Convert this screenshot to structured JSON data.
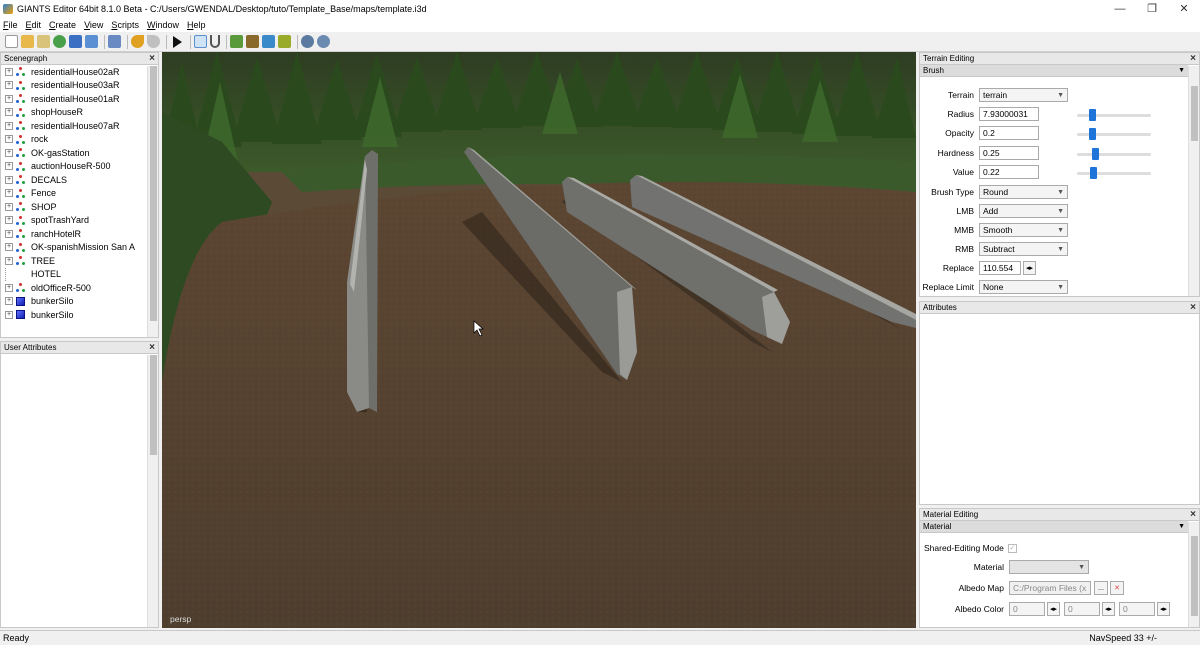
{
  "window": {
    "title": "GIANTS Editor 64bit 8.1.0 Beta - C:/Users/GWENDAL/Desktop/tuto/Template_Base/maps/template.i3d",
    "minimize": "—",
    "restore": "❐",
    "close": "✕"
  },
  "menu": [
    "File",
    "Edit",
    "Create",
    "View",
    "Scripts",
    "Window",
    "Help"
  ],
  "scenegraph": {
    "title": "Scenegraph",
    "items": [
      {
        "label": "residentialHouse02aR",
        "kind": "node"
      },
      {
        "label": "residentialHouse03aR",
        "kind": "node"
      },
      {
        "label": "residentialHouse01aR",
        "kind": "node"
      },
      {
        "label": "shopHouseR",
        "kind": "node"
      },
      {
        "label": "residentialHouse07aR",
        "kind": "node"
      },
      {
        "label": "rock",
        "kind": "node"
      },
      {
        "label": "OK-gasStation",
        "kind": "node"
      },
      {
        "label": "auctionHouseR-500",
        "kind": "node"
      },
      {
        "label": "DECALS",
        "kind": "node"
      },
      {
        "label": "Fence",
        "kind": "node"
      },
      {
        "label": "SHOP",
        "kind": "node"
      },
      {
        "label": "spotTrashYard",
        "kind": "node"
      },
      {
        "label": "ranchHotelR",
        "kind": "node"
      },
      {
        "label": "OK-spanishMission San A",
        "kind": "node"
      },
      {
        "label": "TREE",
        "kind": "node"
      },
      {
        "label": "HOTEL",
        "kind": "leaf"
      },
      {
        "label": "oldOfficeR-500",
        "kind": "node"
      },
      {
        "label": "bunkerSilo",
        "kind": "shape"
      },
      {
        "label": "bunkerSilo",
        "kind": "shape"
      }
    ]
  },
  "user_attributes": {
    "title": "User Attributes"
  },
  "viewport": {
    "camera_label": "persp"
  },
  "terrain_editing": {
    "title": "Terrain Editing",
    "section": "Brush",
    "terrain_label": "Terrain",
    "terrain_value": "terrain",
    "radius_label": "Radius",
    "radius_value": "7.93000031",
    "radius_level": 0.2,
    "opacity_label": "Opacity",
    "opacity_value": "0.2",
    "opacity_level": 0.2,
    "hardness_label": "Hardness",
    "hardness_value": "0.25",
    "hardness_level": 0.25,
    "value_label": "Value",
    "value_value": "0.22",
    "value_level": 0.22,
    "brush_type_label": "Brush Type",
    "brush_type_value": "Round",
    "lmb_label": "LMB",
    "lmb_value": "Add",
    "mmb_label": "MMB",
    "mmb_value": "Smooth",
    "rmb_label": "RMB",
    "rmb_value": "Subtract",
    "replace_label": "Replace",
    "replace_value": "110.554",
    "replace_limit_label": "Replace Limit",
    "replace_limit_value": "None"
  },
  "attributes": {
    "title": "Attributes"
  },
  "material_editing": {
    "title": "Material Editing",
    "section": "Material",
    "shared_mode_label": "Shared-Editing Mode",
    "material_label": "Material",
    "albedo_map_label": "Albedo Map",
    "albedo_map_value": "C:/Program Files (x",
    "albedo_map_browse": "...",
    "albedo_color_label": "Albedo Color",
    "albedo_color_values": [
      "0",
      "0",
      "0"
    ]
  },
  "status": {
    "left": "Ready",
    "right": "NavSpeed 33 +/-"
  },
  "colors": {
    "accent": "#1e74d8",
    "ground": "#5a4a36",
    "concrete": "#7d7d7a"
  }
}
